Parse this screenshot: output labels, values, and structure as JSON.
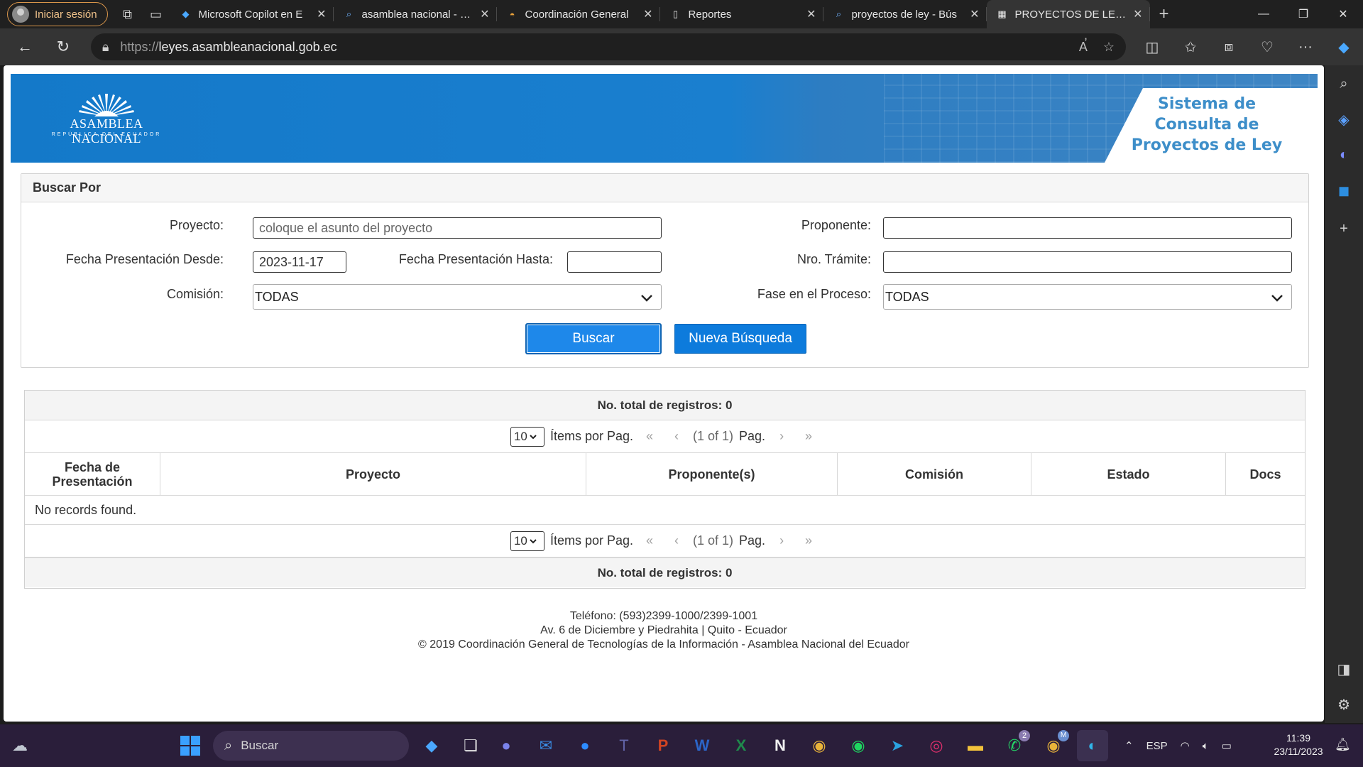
{
  "browser": {
    "profile_label": "Iniciar sesión",
    "tabs": [
      {
        "title": "Microsoft Copilot en E",
        "icon": "copilot-icon"
      },
      {
        "title": "asamblea nacional - Bu",
        "icon": "search-icon"
      },
      {
        "title": "Coordinación General",
        "icon": "rainbow-icon"
      },
      {
        "title": "Reportes",
        "icon": "page-icon"
      },
      {
        "title": "proyectos de ley - Bús",
        "icon": "search-icon"
      },
      {
        "title": "PROYECTOS DE LEY - F",
        "icon": "site-icon"
      }
    ],
    "url_prefix": "https://",
    "url_host": "leyes.asambleanacional.gob.ec"
  },
  "banner": {
    "logo_name": "ASAMBLEA NACIONAL",
    "logo_sub": "REPÚBLICA DEL ECUADOR",
    "title_line1": "Sistema de",
    "title_line2": "Consulta de",
    "title_line3": "Proyectos de Ley"
  },
  "search": {
    "heading": "Buscar Por",
    "proyecto_label": "Proyecto:",
    "proyecto_placeholder": "coloque el asunto del proyecto",
    "proponente_label": "Proponente:",
    "proponente_value": "",
    "fecha_desde_label": "Fecha Presentación Desde:",
    "fecha_desde_value": "2023-11-17",
    "fecha_hasta_label": "Fecha Presentación Hasta:",
    "fecha_hasta_value": "",
    "tramite_label": "Nro. Trámite:",
    "tramite_value": "",
    "comision_label": "Comisión:",
    "comision_value": "TODAS",
    "fase_label": "Fase en el Proceso:",
    "fase_value": "TODAS",
    "buscar_label": "Buscar",
    "nueva_label": "Nueva Búsqueda"
  },
  "results": {
    "total_text": "No. total de registros: 0",
    "rows_per_page": "10",
    "items_label": "Ítems por Pag.",
    "page_status": "(1 of 1)",
    "pag_label": "Pag.",
    "columns": [
      "Fecha de Presentación",
      "Proyecto",
      "Proponente(s)",
      "Comisión",
      "Estado",
      "Docs"
    ],
    "empty_message": "No records found."
  },
  "footer": {
    "line1": "Teléfono: (593)2399-1000/2399-1001",
    "line2": "Av. 6 de Diciembre y Piedrahita | Quito - Ecuador",
    "line3": "© 2019 Coordinación General de Tecnologías de la Información - Asamblea Nacional del Ecuador"
  },
  "taskbar": {
    "search_label": "Buscar",
    "lang": "ESP",
    "time": "11:39",
    "date": "23/11/2023",
    "whatsapp_badge": "2",
    "chrome_badge": "M"
  },
  "colors": {
    "banner_blue": "#1479c9",
    "button_blue": "#0d7bdc",
    "title_blue": "#3d8ec9"
  }
}
